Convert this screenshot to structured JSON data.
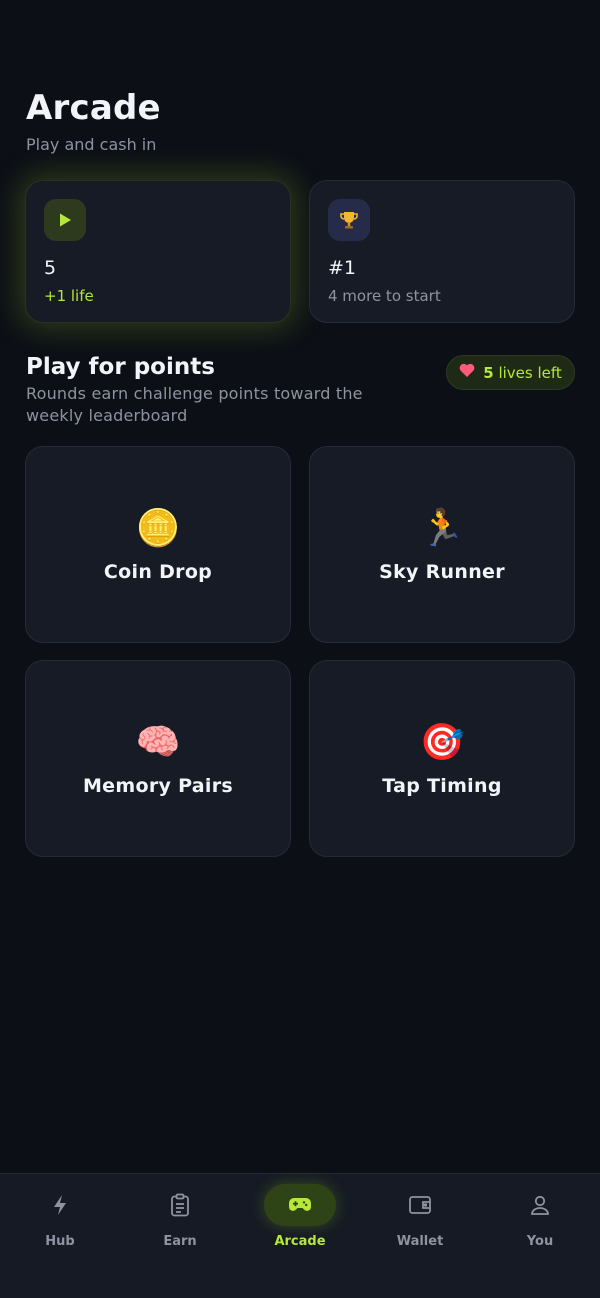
{
  "header": {
    "title": "Arcade",
    "subtitle": "Play and cash in"
  },
  "stats": [
    {
      "icon": "play-icon",
      "value": "5",
      "sub": "+1 life"
    },
    {
      "icon": "trophy-icon",
      "value": "#1",
      "sub": "4 more to start"
    }
  ],
  "section": {
    "title": "Play for points",
    "description": "Rounds earn challenge points toward the weekly leaderboard",
    "lives_pill": {
      "count": "5",
      "label": "lives left",
      "icon": "heart-icon"
    }
  },
  "games": [
    {
      "name": "Coin Drop",
      "emoji": "🪙"
    },
    {
      "name": "Sky Runner",
      "emoji": "🏃"
    },
    {
      "name": "Memory Pairs",
      "emoji": "🧠"
    },
    {
      "name": "Tap Timing",
      "emoji": "🎯"
    }
  ],
  "tabs": [
    {
      "label": "Hub",
      "icon": "bolt-icon"
    },
    {
      "label": "Earn",
      "icon": "clipboard-icon"
    },
    {
      "label": "Arcade",
      "icon": "gamepad-icon",
      "active": true
    },
    {
      "label": "Wallet",
      "icon": "wallet-icon"
    },
    {
      "label": "You",
      "icon": "user-icon"
    }
  ],
  "colors": {
    "accent": "#b6e83a",
    "background": "#0c0f16",
    "card": "#161b25",
    "heart": "#ff5a7a"
  }
}
